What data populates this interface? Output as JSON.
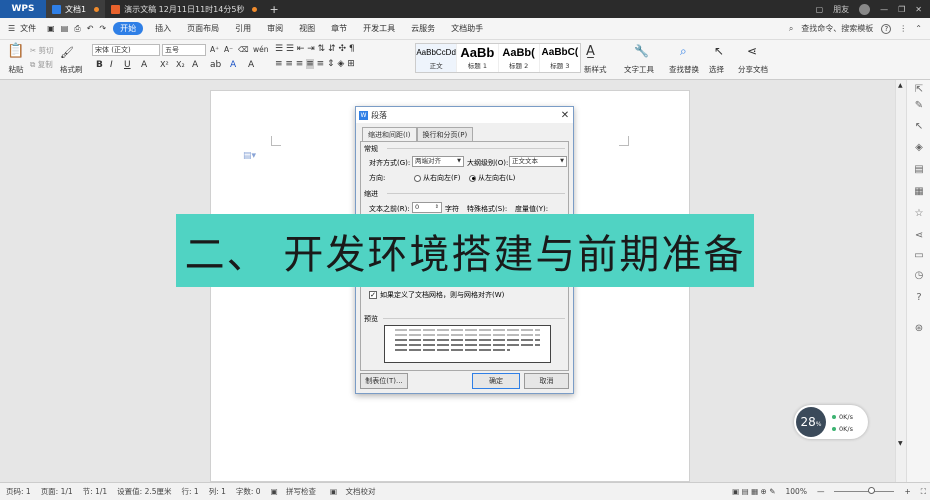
{
  "titlebar": {
    "app_label": "WPS",
    "tabs": [
      {
        "label": "文档1",
        "active": true
      },
      {
        "label": "演示文稿 12月11日11时14分5秒",
        "active": false
      }
    ],
    "new_tab": "+",
    "user": "朋友"
  },
  "menubar": {
    "file": "文件",
    "items": [
      "开始",
      "插入",
      "页面布局",
      "引用",
      "审阅",
      "视图",
      "章节",
      "开发工具",
      "云服务",
      "文档助手"
    ],
    "search": "查找命令、搜索模板",
    "help": "?"
  },
  "ribbon": {
    "paste": "粘贴",
    "cut": "剪切",
    "copy": "复制",
    "format_painter": "格式刷",
    "font_name": "宋体 (正文)",
    "font_size": "五号",
    "styles": [
      {
        "sample": "AaBbCcDd",
        "label": "正文"
      },
      {
        "sample": "AaBb",
        "label": "标题 1"
      },
      {
        "sample": "AaBb(",
        "label": "标题 2"
      },
      {
        "sample": "AaBbC(",
        "label": "标题 3"
      }
    ],
    "new_style": "新样式",
    "text_tools": "文字工具",
    "find_replace": "查找替换",
    "select": "选择",
    "share": "分享文档"
  },
  "dialog": {
    "title": "段落",
    "tabs": [
      "缩进和间距(I)",
      "换行和分页(P)"
    ],
    "general": "常规",
    "alignment_label": "对齐方式(G):",
    "alignment_value": "两端对齐",
    "outline_label": "大纲级别(O):",
    "outline_value": "正文文本",
    "direction_label": "方向:",
    "direction_rtl": "从右向左(F)",
    "direction_ltr": "从左向右(L)",
    "indent": "缩进",
    "before_text_label": "文本之前(R):",
    "before_text_value": "0",
    "before_text_unit": "字符",
    "special_label": "特殊格式(S):",
    "measure_label": "度量值(Y):",
    "grid_checkbox": "如果定义了文档网格，则与网格对齐(W)",
    "preview": "预览",
    "tabs_button": "制表位(T)...",
    "ok": "确定",
    "cancel": "取消"
  },
  "banner": {
    "text": "二、 开发环境搭建与前期准备",
    "color": "#50d3c3"
  },
  "statusbar": {
    "page_code": "页码: 1",
    "pages": "页面: 1/1",
    "section": "节: 1/1",
    "setting": "设置值: 2.5厘米",
    "row": "行: 1",
    "col": "列: 1",
    "words": "字数: 0",
    "spell": "拼写检查",
    "proof": "文档校对",
    "zoom": "100%"
  },
  "network_widget": {
    "percent": "28",
    "percent_unit": "%",
    "up": "0K/s",
    "down": "0K/s"
  }
}
